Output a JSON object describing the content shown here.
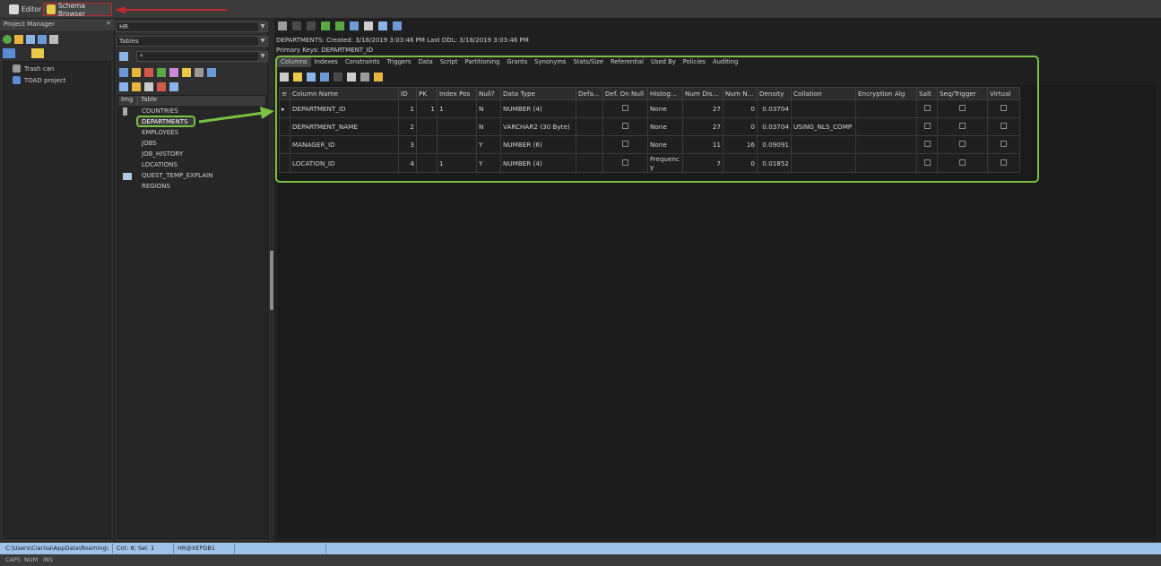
{
  "topbar": {
    "editor_label": "Editor",
    "schema_label": "Schema Browser"
  },
  "project_manager": {
    "title": "Project Manager",
    "tree": [
      "Trash can",
      "TOAD project"
    ]
  },
  "schema_browser": {
    "schema_value": "HR",
    "object_type_value": "Tables",
    "filter_value": "*",
    "list_header_img": "Img",
    "list_header_table": "Table",
    "tables": [
      "COUNTRIES",
      "DEPARTMENTS",
      "EMPLOYEES",
      "JOBS",
      "JOB_HISTORY",
      "LOCATIONS",
      "QUEST_TEMP_EXPLAIN",
      "REGIONS"
    ]
  },
  "object_info": {
    "line1": "DEPARTMENTS:  Created: 3/18/2019 3:03:46 PM  Last DDL: 3/18/2019 3:03:46 PM",
    "line2": "Primary Keys: DEPARTMENT_ID"
  },
  "tabs": [
    "Columns",
    "Indexes",
    "Constraints",
    "Triggers",
    "Data",
    "Script",
    "Partitioning",
    "Grants",
    "Synonyms",
    "Stats/Size",
    "Referential",
    "Used By",
    "Policies",
    "Auditing"
  ],
  "grid": {
    "headers": [
      "Column Name",
      "ID",
      "PK",
      "Index Pos",
      "Null?",
      "Data Type",
      "Defa...",
      "Def. On Null",
      "Histog...",
      "Num Dis...",
      "Num N...",
      "Density",
      "Collation",
      "Encryption Alg",
      "Salt",
      "Seq/Trigger",
      "Virtual"
    ],
    "rows": [
      {
        "name": "DEPARTMENT_ID",
        "id": "1",
        "pk": "1",
        "idxpos": "1",
        "null": "N",
        "type": "NUMBER (4)",
        "hist": "None",
        "numdis": "27",
        "numn": "0",
        "density": "0.03704",
        "collation": ""
      },
      {
        "name": "DEPARTMENT_NAME",
        "id": "2",
        "pk": "",
        "idxpos": "",
        "null": "N",
        "type": "VARCHAR2 (30 Byte)",
        "hist": "None",
        "numdis": "27",
        "numn": "0",
        "density": "0.03704",
        "collation": "USING_NLS_COMP"
      },
      {
        "name": "MANAGER_ID",
        "id": "3",
        "pk": "",
        "idxpos": "",
        "null": "Y",
        "type": "NUMBER (6)",
        "hist": "None",
        "numdis": "11",
        "numn": "16",
        "density": "0.09091",
        "collation": ""
      },
      {
        "name": "LOCATION_ID",
        "id": "4",
        "pk": "",
        "idxpos": "1",
        "null": "Y",
        "type": "NUMBER (4)",
        "hist": "Frequency",
        "numdis": "7",
        "numn": "0",
        "density": "0.01852",
        "collation": ""
      }
    ]
  },
  "status": {
    "path": "C:\\Users\\Clarisa\\AppData\\Roaming\\",
    "count": "Cnt: 8; Sel: 1",
    "connection": "HR@XEPDB1",
    "caps": "CAPS",
    "num": "NUM",
    "ins": "INS"
  },
  "colors": {
    "highlight_green": "#7ac142",
    "highlight_red": "#c0282d",
    "status_blue": "#9ec2e8"
  }
}
